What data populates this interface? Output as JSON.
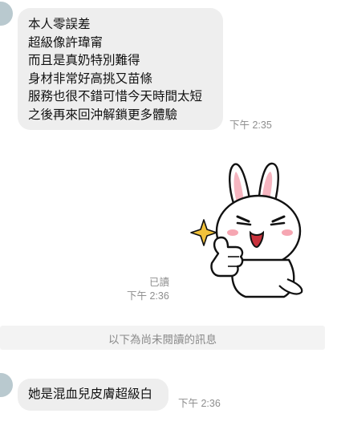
{
  "chat": {
    "message_1": {
      "lines": [
        "本人零誤差",
        "超級像許瑋甯",
        "而且是真奶特別難得",
        "身材非常好高挑又苗條",
        "服務也很不錯可惜今天時間太短",
        "之後再來回沖解鎖更多體驗"
      ],
      "time": "下午 2:35"
    },
    "sticker_message": {
      "sticker_icon": "cony-rabbit-thumbs-up-sticker",
      "read_status": "已讀",
      "time": "下午 2:36"
    },
    "unread_divider": "以下為尚未閱讀的訊息",
    "message_2": {
      "text": "她是混血兒皮膚超級白",
      "time": "下午 2:36"
    }
  },
  "colors": {
    "bubble_bg": "#eeeeee",
    "divider_bg": "#f3f3f3",
    "timestamp": "#8e8e8e",
    "avatar": "#b9c9cf",
    "sparkle": "#f2c23a",
    "cheek": "#f6a6b2"
  }
}
